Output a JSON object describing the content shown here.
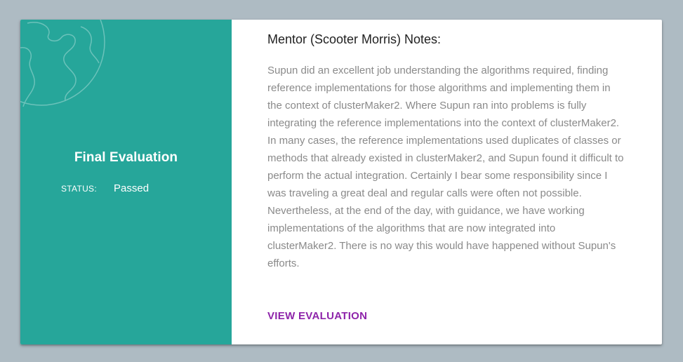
{
  "evaluation": {
    "title": "Final Evaluation",
    "status_label": "STATUS:",
    "status_value": "Passed"
  },
  "notes": {
    "heading": "Mentor (Scooter Morris) Notes:",
    "body": "Supun did an excellent job understanding the algorithms required, finding reference implementations for those algorithms and implementing them in the context of clusterMaker2. Where Supun ran into problems is fully integrating the reference implementations into the context of clusterMaker2. In many cases, the reference implementations used duplicates of classes or methods that already existed in clusterMaker2, and Supun found it difficult to perform the actual integration. Certainly I bear some responsibility since I was traveling a great deal and regular calls were often not possible. Nevertheless, at the end of the day, with guidance, we have working implementations of the algorithms that are now integrated into clusterMaker2. There is no way this would have happened without Supun's efforts.",
    "link_label": "VIEW EVALUATION"
  },
  "icons": {
    "background_decoration": "globe-icon"
  },
  "colors": {
    "page_background": "#aebbc3",
    "panel_teal": "#26a69a",
    "link_purple": "#8e24aa",
    "body_text": "#8a8a8a"
  }
}
